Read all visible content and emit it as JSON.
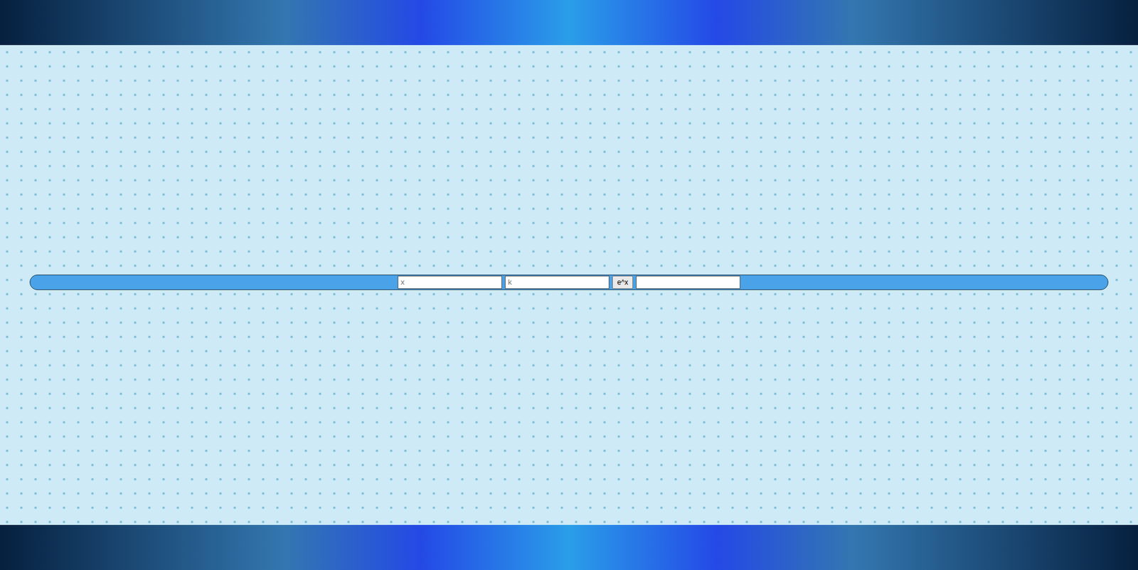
{
  "form": {
    "x_field": {
      "placeholder": "x",
      "value": ""
    },
    "k_field": {
      "placeholder": "k",
      "value": ""
    },
    "button": "e^x",
    "result_field": {
      "value": ""
    }
  }
}
